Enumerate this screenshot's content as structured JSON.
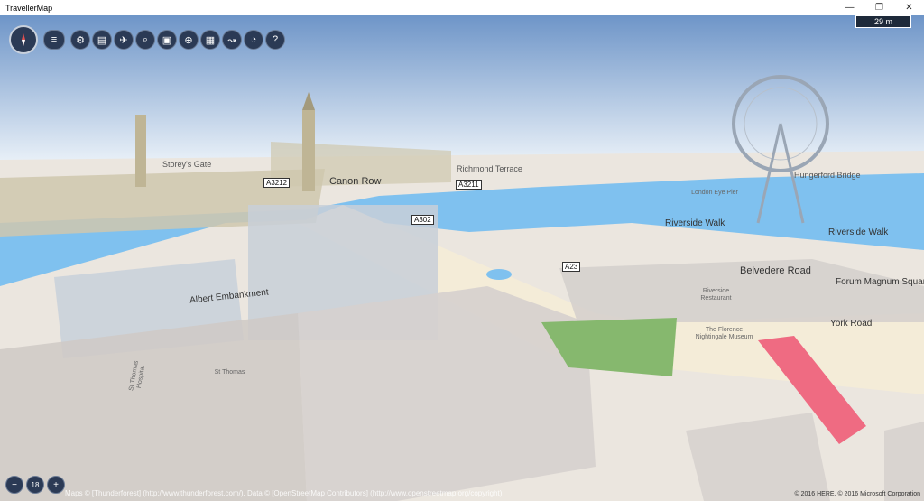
{
  "window": {
    "title": "TravellerMap",
    "minimize": "—",
    "maximize": "❐",
    "close": "✕"
  },
  "scale": {
    "label": "29 m"
  },
  "toolbar": {
    "menu_icon": "≡",
    "buttons": [
      {
        "name": "settings-icon",
        "glyph": "⚙"
      },
      {
        "name": "layers-icon",
        "glyph": "▤"
      },
      {
        "name": "satellite-icon",
        "glyph": "✈"
      },
      {
        "name": "search-icon",
        "glyph": "⌕"
      },
      {
        "name": "save-icon",
        "glyph": "▣"
      },
      {
        "name": "locate-icon",
        "glyph": "⊕"
      },
      {
        "name": "transport-icon",
        "glyph": "▦"
      },
      {
        "name": "route-icon",
        "glyph": "↝"
      },
      {
        "name": "tracking-icon",
        "glyph": "◔"
      },
      {
        "name": "help-icon",
        "glyph": "?"
      }
    ]
  },
  "zoom": {
    "out": "−",
    "level": "18",
    "in": "+"
  },
  "map": {
    "streets": [
      {
        "name": "Canon Row"
      },
      {
        "name": "Albert Embankment"
      },
      {
        "name": "Belvedere Road"
      },
      {
        "name": "Riverside Walk"
      },
      {
        "name": "Riverside Walk"
      },
      {
        "name": "York Road"
      },
      {
        "name": "Forum Magnum Square"
      },
      {
        "name": "Richmond Terrace"
      },
      {
        "name": "Storey's Gate"
      },
      {
        "name": "Hungerford Bridge"
      }
    ],
    "shields": [
      "A3212",
      "A3211",
      "A302",
      "A23"
    ],
    "pois": [
      {
        "name": "London Eye Pier"
      },
      {
        "name": "Riverside Restaurant"
      },
      {
        "name": "The Florence Nightingale Museum"
      },
      {
        "name": "St Thomas Hospital"
      },
      {
        "name": "St Thomas"
      }
    ]
  },
  "attribution": "Maps © [Thunderforest] (http://www.thunderforest.com/), Data © [OpenStreetMap Contributors] (http://www.openstreetmap.org/copyright)",
  "copyright": "© 2016 HERE, © 2016 Microsoft Corporation"
}
